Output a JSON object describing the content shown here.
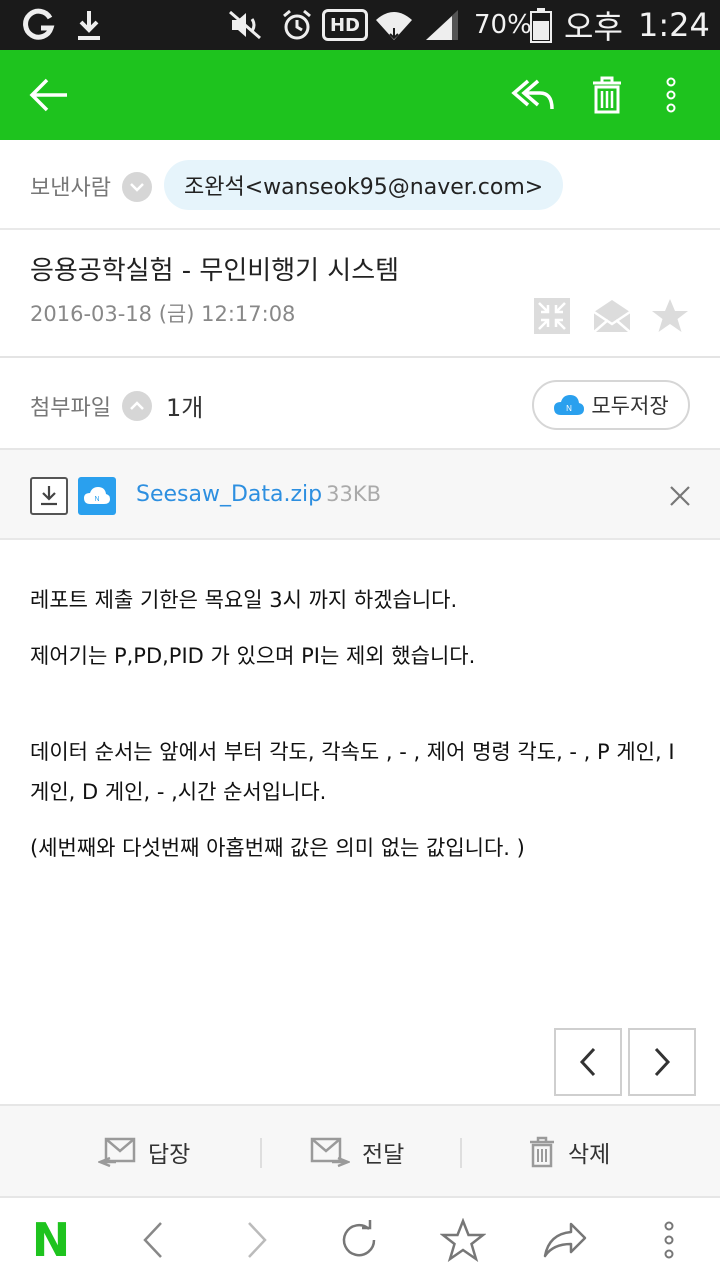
{
  "status_bar": {
    "battery_percent": "70%",
    "ampm": "오후",
    "time": "1:24",
    "hd_label": "HD"
  },
  "app_bar": {
    "accent": "#1ec31e"
  },
  "sender": {
    "label": "보낸사람",
    "value": "조완석<wanseok95@naver.com>"
  },
  "mail": {
    "subject": "응용공학실험 - 무인비행기 시스템",
    "date": "2016-03-18 (금) 12:17:08"
  },
  "attachments": {
    "label": "첨부파일",
    "count": "1개",
    "save_all": "모두저장",
    "files": [
      {
        "name": "Seesaw_Data.zip",
        "size": "33KB"
      }
    ]
  },
  "body": {
    "paragraphs": [
      "레포트 제출 기한은 목요일 3시 까지 하겠습니다.",
      "제어기는 P,PD,PID 가 있으며 PI는 제외 했습니다.",
      "데이터 순서는 앞에서 부터  각도, 각속도 ,  -  , 제어 명령 각도, - , P 게인, I 게인, D 게인, - ,시간   순서입니다.",
      "(세번째와 다섯번째 아홉번째 값은 의미 없는 값입니다. )"
    ]
  },
  "actions": {
    "reply": "답장",
    "forward": "전달",
    "delete": "삭제"
  },
  "browser": {
    "logo": "N",
    "logo_color": "#1ec31e"
  }
}
